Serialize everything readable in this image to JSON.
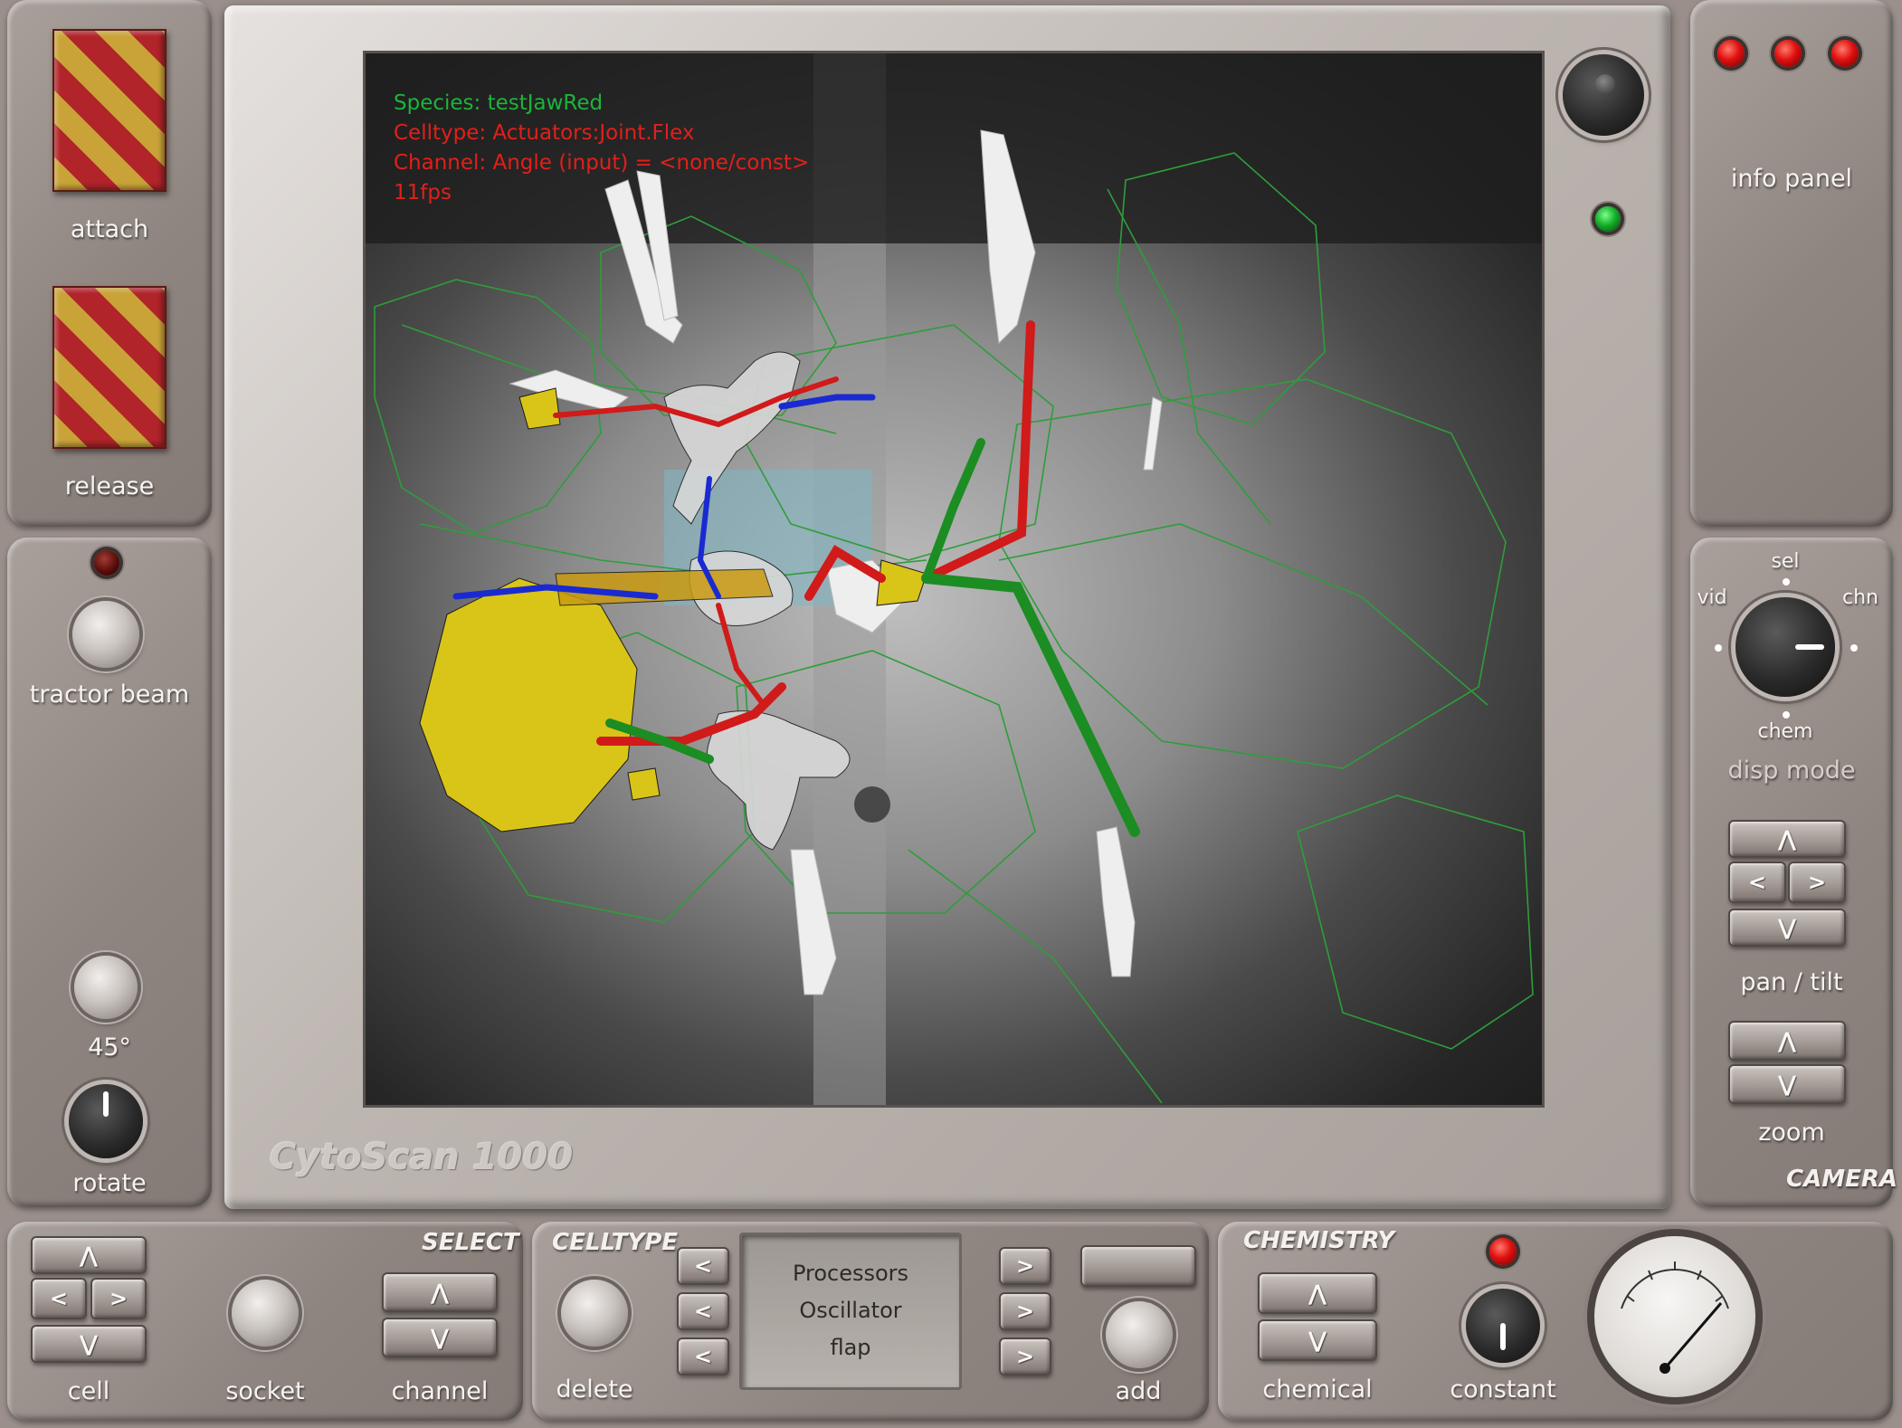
{
  "left_panel": {
    "attach_label": "attach",
    "release_label": "release",
    "tractor_beam_label": "tractor beam",
    "angle_value": "45°",
    "rotate_label": "rotate"
  },
  "right_panel": {
    "info_label": "info panel",
    "disp_mode": {
      "label": "disp mode",
      "sel": "sel",
      "vid": "vid",
      "chn": "chn",
      "chem": "chem"
    },
    "pan_tilt_label": "pan / tilt",
    "zoom_label": "zoom",
    "camera_label": "CAMERA"
  },
  "screen": {
    "species_line": "Species: testJawRed",
    "celltype_line": "Celltype: Actuators:Joint.Flex",
    "channel_line": "Channel: Angle (input) = <none/const>",
    "fps_line": "11fps",
    "brand": "CytoScan 1000"
  },
  "bottom": {
    "cell_label": "cell",
    "socket_label": "socket",
    "select_label": "SELECT",
    "channel_label": "channel",
    "celltype_label": "CELLTYPE",
    "delete_label": "delete",
    "celltype_list": [
      "Processors",
      "Oscillator",
      "flap"
    ],
    "add_label": "add",
    "chemistry_label": "CHEMISTRY",
    "chemical_label": "chemical",
    "constant_label": "constant"
  },
  "colors": {
    "hud_green": "#1db33a",
    "hud_red": "#e0201a",
    "panel": "#948a85"
  },
  "icons": {
    "up": "⋀",
    "down": "⋁",
    "left": "<",
    "right": ">"
  }
}
